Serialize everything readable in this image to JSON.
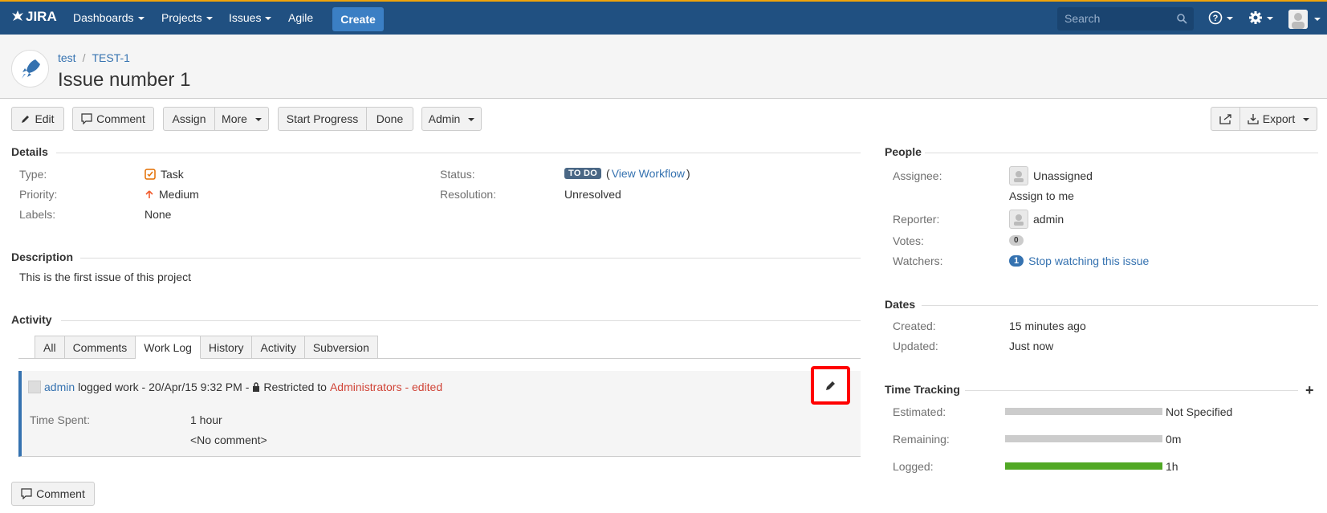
{
  "nav": {
    "logo": "JIRA",
    "dashboards": "Dashboards",
    "projects": "Projects",
    "issues": "Issues",
    "agile": "Agile",
    "create": "Create",
    "search_placeholder": "Search"
  },
  "header": {
    "project": "test",
    "issue_key": "TEST-1",
    "title": "Issue number 1"
  },
  "toolbar": {
    "edit": "Edit",
    "comment": "Comment",
    "assign": "Assign",
    "more": "More",
    "start_progress": "Start Progress",
    "done": "Done",
    "admin": "Admin",
    "export": "Export"
  },
  "details": {
    "heading": "Details",
    "type_label": "Type:",
    "type_value": "Task",
    "priority_label": "Priority:",
    "priority_value": "Medium",
    "labels_label": "Labels:",
    "labels_value": "None",
    "status_label": "Status:",
    "status_value": "TO DO",
    "view_workflow": "View Workflow",
    "resolution_label": "Resolution:",
    "resolution_value": "Unresolved"
  },
  "description": {
    "heading": "Description",
    "text": "This is the first issue of this project"
  },
  "activity": {
    "heading": "Activity",
    "tabs": [
      "All",
      "Comments",
      "Work Log",
      "History",
      "Activity",
      "Subversion"
    ],
    "worklog": {
      "user": "admin",
      "action": "logged work - 20/Apr/15 9:32 PM -",
      "restricted": "Restricted to",
      "group": "Administrators",
      "edited": "- edited",
      "time_spent_label": "Time Spent:",
      "time_spent_value": "1 hour",
      "comment": "<No comment>"
    },
    "comment_button": "Comment"
  },
  "people": {
    "heading": "People",
    "assignee_label": "Assignee:",
    "assignee_value": "Unassigned",
    "assign_to_me": "Assign to me",
    "reporter_label": "Reporter:",
    "reporter_value": "admin",
    "votes_label": "Votes:",
    "votes_value": "0",
    "watchers_label": "Watchers:",
    "watchers_count": "1",
    "stop_watching": "Stop watching this issue"
  },
  "dates": {
    "heading": "Dates",
    "created_label": "Created:",
    "created_value": "15 minutes ago",
    "updated_label": "Updated:",
    "updated_value": "Just now"
  },
  "time_tracking": {
    "heading": "Time Tracking",
    "estimated_label": "Estimated:",
    "estimated_value": "Not Specified",
    "remaining_label": "Remaining:",
    "remaining_value": "0m",
    "logged_label": "Logged:",
    "logged_value": "1h"
  },
  "colors": {
    "nav_bg": "#205081",
    "accent": "#3572b0",
    "logged_bar": "#51a825",
    "highlight": "#ff0000"
  }
}
